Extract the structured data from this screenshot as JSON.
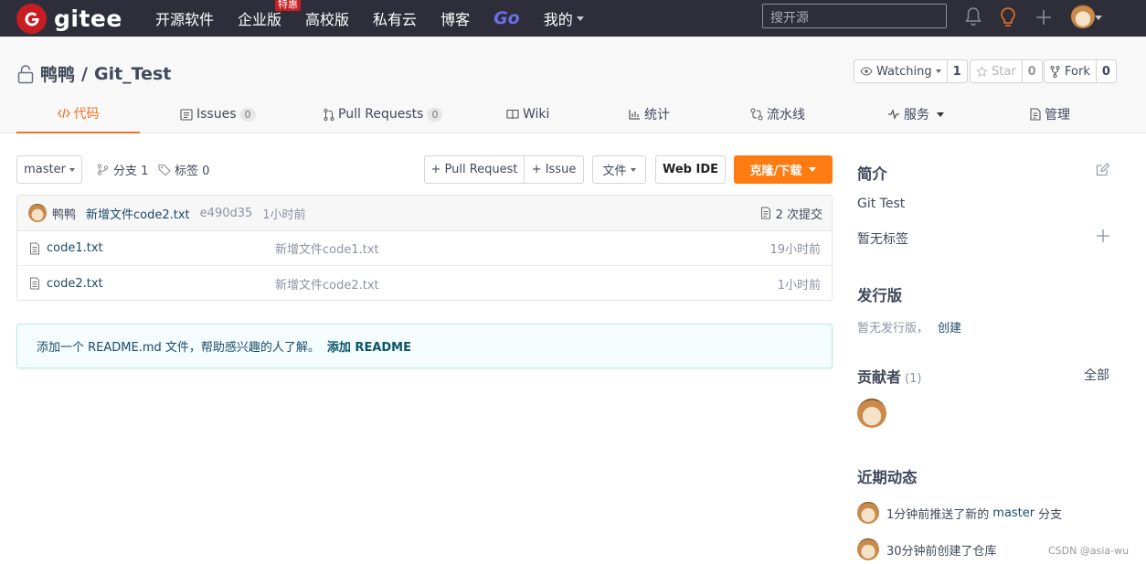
{
  "nav": {
    "logo_text": "gitee",
    "links": [
      "开源软件",
      "企业版",
      "高校版",
      "私有云",
      "博客",
      "Go",
      "我的"
    ],
    "hot_badge": "特惠",
    "search_placeholder": "搜开源"
  },
  "repo": {
    "owner": "鸭鸭",
    "separator": "/",
    "name": "Git_Test",
    "watch": {
      "label": "Watching",
      "count": "1"
    },
    "star": {
      "label": "Star",
      "count": "0"
    },
    "fork": {
      "label": "Fork",
      "count": "0"
    }
  },
  "tabs": {
    "code": "代码",
    "issues": "Issues",
    "issues_count": "0",
    "pulls": "Pull Requests",
    "pulls_count": "0",
    "wiki": "Wiki",
    "stats": "统计",
    "pipeline": "流水线",
    "services": "服务",
    "manage": "管理"
  },
  "toolbar": {
    "branch": "master",
    "branches": "分支 1",
    "tags": "标签 0",
    "pull_request": "+ Pull Request",
    "issue": "+ Issue",
    "file": "文件",
    "web_ide": "Web IDE",
    "clone": "克隆/下载"
  },
  "commit": {
    "author": "鸭鸭",
    "message": "新增文件code2.txt",
    "hash": "e490d35",
    "time": "1小时前",
    "commits": "2 次提交"
  },
  "files": [
    {
      "name": "code1.txt",
      "message": "新增文件code1.txt",
      "time": "19小时前"
    },
    {
      "name": "code2.txt",
      "message": "新增文件code2.txt",
      "time": "1小时前"
    }
  ],
  "readme_notice": {
    "text": "添加一个 README.md 文件，帮助感兴趣的人了解。",
    "action": "添加 README"
  },
  "sidebar": {
    "intro_title": "简介",
    "intro_text": "Git Test",
    "no_tags": "暂无标签",
    "release_title": "发行版",
    "no_release": "暂无发行版，",
    "create": "创建",
    "contributors_title": "贡献者",
    "contributors_count": "(1)",
    "all": "全部",
    "activity_title": "近期动态",
    "activity": [
      {
        "prefix": "1分钟前推送了新的",
        "branch": "master",
        "suffix": "分支"
      },
      {
        "prefix": "30分钟前创建了仓库",
        "branch": "",
        "suffix": ""
      }
    ]
  },
  "watermark": "CSDN @asia-wu",
  "colors": {
    "accent": "#f37022",
    "clone": "#fd7b11",
    "nav_bg": "#2e2e3b",
    "brand": "#c71d23"
  }
}
